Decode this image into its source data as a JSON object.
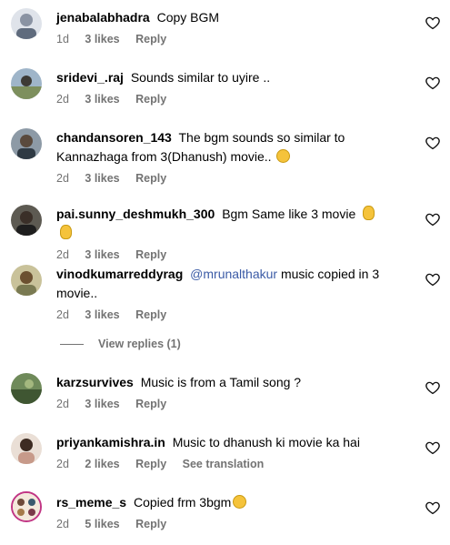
{
  "comments": [
    {
      "username": "jenabalabhadra",
      "text": "Copy BGM",
      "time": "1d",
      "likes": "3 likes",
      "reply": "Reply"
    },
    {
      "username": "sridevi_.raj",
      "text": "Sounds similar to uyire ..",
      "time": "2d",
      "likes": "3 likes",
      "reply": "Reply"
    },
    {
      "username": "chandansoren_143",
      "text": "The bgm sounds so similar to Kannazhaga from 3(Dhanush) movie..",
      "time": "2d",
      "likes": "3 likes",
      "reply": "Reply",
      "emoji": "face-emoji"
    },
    {
      "username": "pai.sunny_deshmukh_300",
      "text": "Bgm Same like 3 movie",
      "time": "2d",
      "likes": "3 likes",
      "reply": "Reply",
      "emoji": "ok-hand-emoji"
    },
    {
      "username": "vinodkumarreddyrag",
      "mention": "@mrunalthakur",
      "text": "music copied in 3 movie..",
      "time": "2d",
      "likes": "3 likes",
      "reply": "Reply",
      "view_replies": "View replies (1)"
    },
    {
      "username": "karzsurvives",
      "text": "Music is from a Tamil song ?",
      "time": "2d",
      "likes": "3 likes",
      "reply": "Reply"
    },
    {
      "username": "priyankamishra.in",
      "text": "Music to dhanush ki movie ka hai",
      "time": "2d",
      "likes": "2 likes",
      "reply": "Reply",
      "see_translation": "See translation"
    },
    {
      "username": "rs_meme_s",
      "text": "Copied frm 3bgm",
      "time": "2d",
      "likes": "5 likes",
      "reply": "Reply",
      "emoji": "face-emoji"
    }
  ],
  "icons": {
    "like": "heart-outline-icon"
  },
  "colors": {
    "meta_text": "#737373",
    "mention": "#3b5ba6"
  }
}
